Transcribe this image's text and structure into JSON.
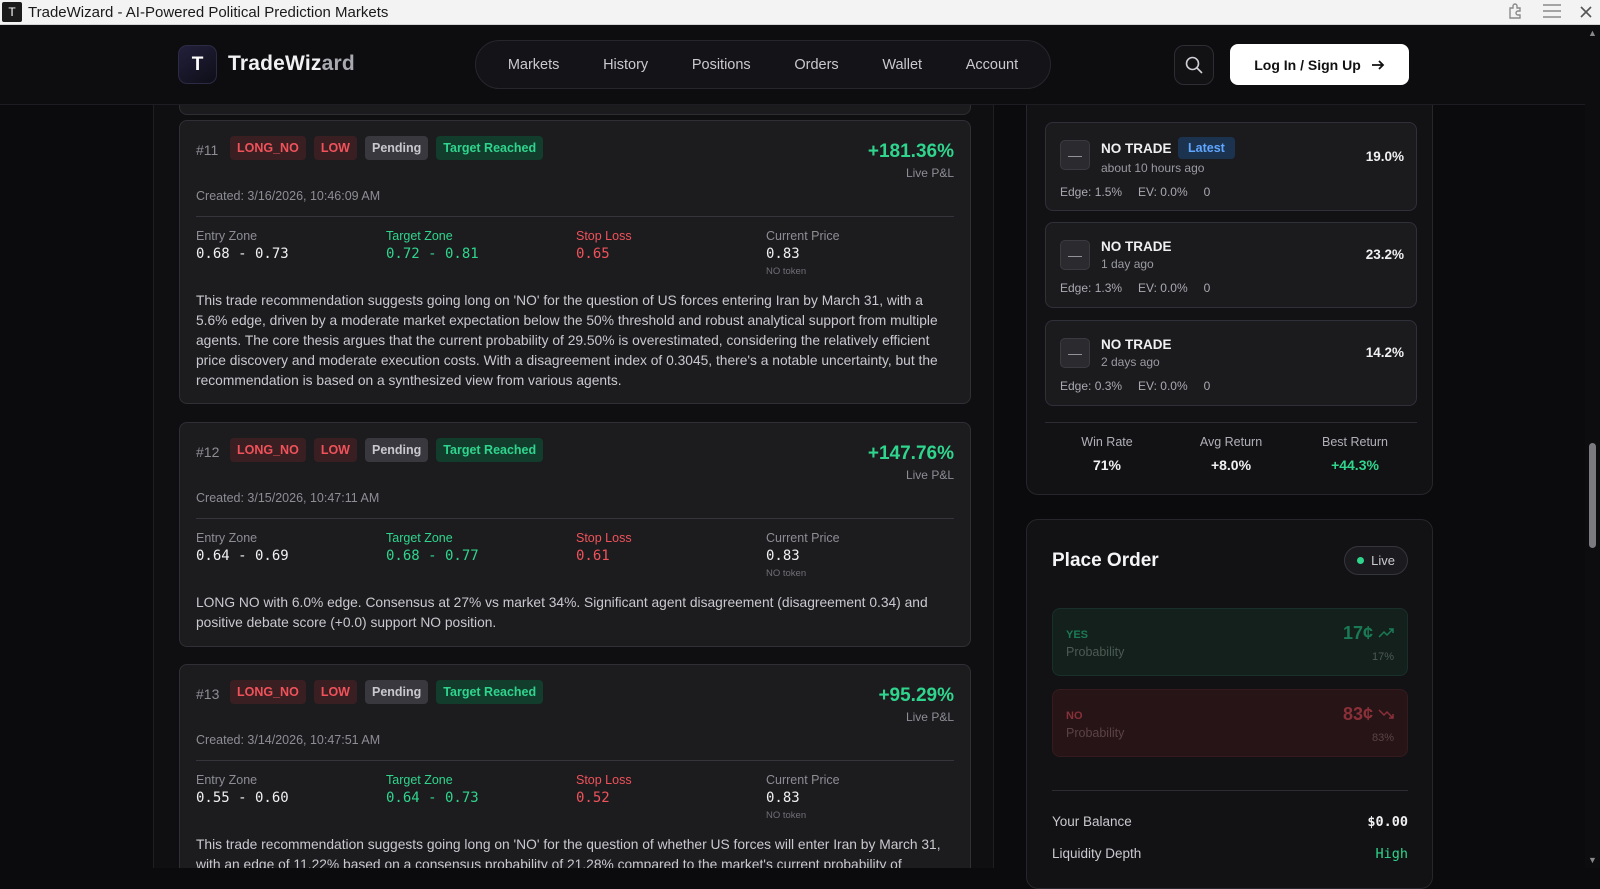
{
  "window": {
    "title": "TradeWizard - AI-Powered Political Prediction Markets",
    "app_icon_letter": "T"
  },
  "header": {
    "logo_letter": "T",
    "brand_prefix": "TradeWiz",
    "brand_suffix": "ard",
    "nav": [
      "Markets",
      "History",
      "Positions",
      "Orders",
      "Wallet",
      "Account"
    ],
    "login_label": "Log In / Sign Up"
  },
  "recommendations": [
    {
      "num": "#11",
      "direction": "LONG_NO",
      "confidence": "LOW",
      "status": "Pending",
      "outcome": "Target Reached",
      "pnl": "+181.36%",
      "pnl_label": "Live P&L",
      "created": "Created: 3/16/2026, 10:46:09 AM",
      "entry_label": "Entry Zone",
      "entry": "0.68 - 0.73",
      "target_label": "Target Zone",
      "target": "0.72 - 0.81",
      "stop_label": "Stop Loss",
      "stop": "0.65",
      "current_label": "Current Price",
      "current": "0.83",
      "token": "NO token",
      "description": "This trade recommendation suggests going long on 'NO' for the question of US forces entering Iran by March 31, with a 5.6% edge, driven by a moderate market expectation below the 50% threshold and robust analytical support from multiple agents. The core thesis argues that the current probability of 29.50% is overestimated, considering the relatively efficient price discovery and moderate execution costs. With a disagreement index of 0.3045, there's a notable uncertainty, but the recommendation is based on a synthesized view from various agents."
    },
    {
      "num": "#12",
      "direction": "LONG_NO",
      "confidence": "LOW",
      "status": "Pending",
      "outcome": "Target Reached",
      "pnl": "+147.76%",
      "pnl_label": "Live P&L",
      "created": "Created: 3/15/2026, 10:47:11 AM",
      "entry_label": "Entry Zone",
      "entry": "0.64 - 0.69",
      "target_label": "Target Zone",
      "target": "0.68 - 0.77",
      "stop_label": "Stop Loss",
      "stop": "0.61",
      "current_label": "Current Price",
      "current": "0.83",
      "token": "NO token",
      "description": "LONG NO with 6.0% edge. Consensus at 27% vs market 34%. Significant agent disagreement (disagreement 0.34) and positive debate score (+0.0) support NO position."
    },
    {
      "num": "#13",
      "direction": "LONG_NO",
      "confidence": "LOW",
      "status": "Pending",
      "outcome": "Target Reached",
      "pnl": "+95.29%",
      "pnl_label": "Live P&L",
      "created": "Created: 3/14/2026, 10:47:51 AM",
      "entry_label": "Entry Zone",
      "entry": "0.55 - 0.60",
      "target_label": "Target Zone",
      "target": "0.64 - 0.73",
      "stop_label": "Stop Loss",
      "stop": "0.52",
      "current_label": "Current Price",
      "current": "0.83",
      "token": "NO token",
      "description": "This trade recommendation suggests going long on 'NO' for the question of whether US forces will enter Iran by March 31, with an edge of 11.22% based on a consensus probability of 21.28% compared to the market's current probability of"
    }
  ],
  "history": {
    "items": [
      {
        "recommendation": "NO TRADE",
        "tag": "Latest",
        "ago": "about 10 hours ago",
        "pct": "19.0%",
        "edge": "Edge: 1.5%",
        "ev": "EV: 0.0%",
        "count": "0"
      },
      {
        "recommendation": "NO TRADE",
        "tag": "",
        "ago": "1 day ago",
        "pct": "23.2%",
        "edge": "Edge: 1.3%",
        "ev": "EV: 0.0%",
        "count": "0"
      },
      {
        "recommendation": "NO TRADE",
        "tag": "",
        "ago": "2 days ago",
        "pct": "14.2%",
        "edge": "Edge: 0.3%",
        "ev": "EV: 0.0%",
        "count": "0"
      }
    ],
    "stats": [
      {
        "label": "Win Rate",
        "value": "71%",
        "color": "#f0f0f2"
      },
      {
        "label": "Avg Return",
        "value": "+8.0%",
        "color": "#f0f0f2"
      },
      {
        "label": "Best Return",
        "value": "+44.3%",
        "color": "#2fd58d"
      }
    ]
  },
  "order": {
    "title": "Place Order",
    "live_label": "Live",
    "yes": {
      "name": "YES",
      "prob_label": "Probability",
      "price": "17¢",
      "pct": "17%"
    },
    "no": {
      "name": "NO",
      "prob_label": "Probability",
      "price": "83¢",
      "pct": "83%"
    },
    "balance_label": "Your Balance",
    "balance": "$0.00",
    "liquidity_label": "Liquidity Depth",
    "liquidity": "High"
  },
  "colors": {
    "accent_green": "#2fd58d",
    "accent_red": "#f0525a",
    "background": "#0b0b0d"
  }
}
